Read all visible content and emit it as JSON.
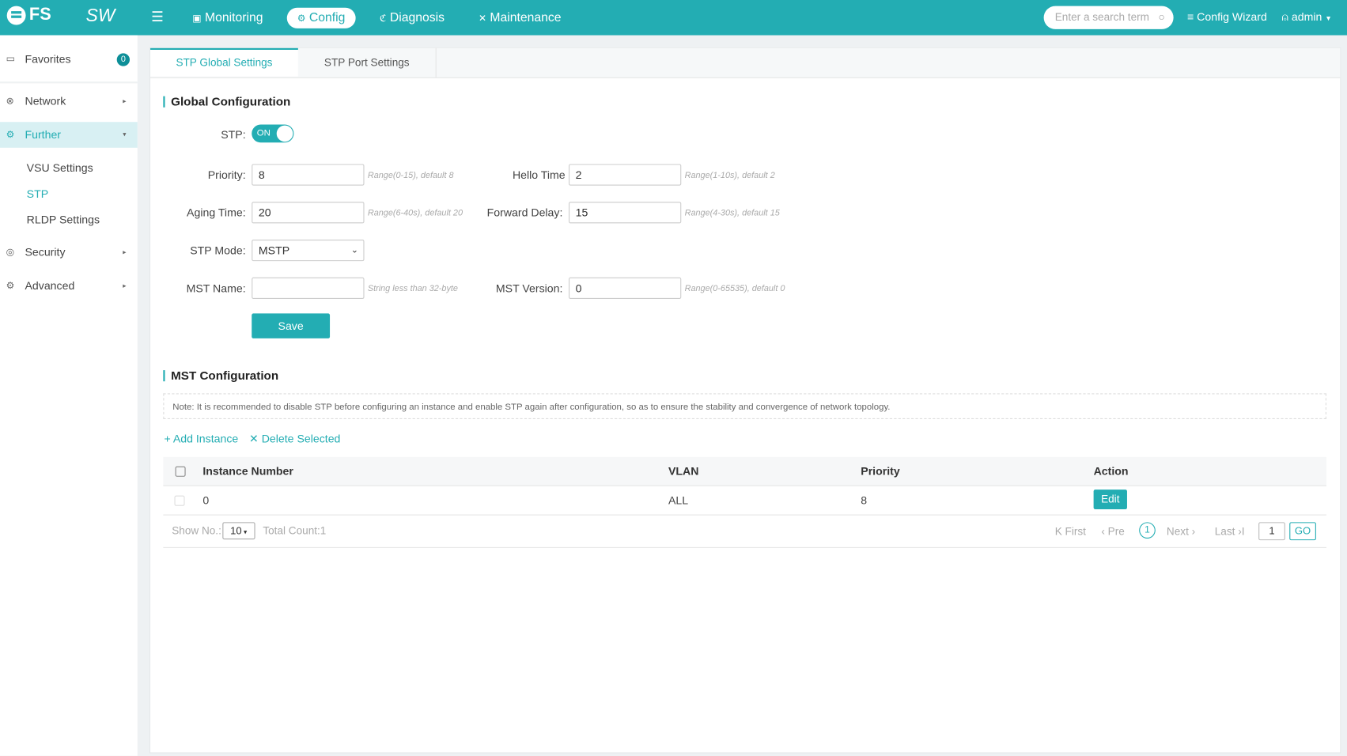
{
  "header": {
    "logo": "FS",
    "product": "SW",
    "nav": [
      {
        "label": "Monitoring",
        "icon": "monitor-icon"
      },
      {
        "label": "Config",
        "icon": "gear-icon"
      },
      {
        "label": "Diagnosis",
        "icon": "stethoscope-icon"
      },
      {
        "label": "Maintenance",
        "icon": "tools-icon"
      }
    ],
    "search_placeholder": "Enter a search term",
    "config_wizard": "Config Wizard",
    "user": "admin"
  },
  "sidebar": {
    "favorites": "Favorites",
    "favorites_count": "0",
    "items": [
      {
        "label": "Network"
      },
      {
        "label": "Further"
      },
      {
        "label": "Security"
      },
      {
        "label": "Advanced"
      }
    ],
    "sub_items": [
      "VSU Settings",
      "STP",
      "RLDP Settings"
    ]
  },
  "tabs": [
    "STP Global Settings",
    "STP Port Settings"
  ],
  "global": {
    "title": "Global Configuration",
    "stp_label": "STP:",
    "stp_state": "ON",
    "priority_label": "Priority:",
    "priority": "8",
    "priority_hint": "Range(0-15), default 8",
    "hello_label": "Hello Time",
    "hello": "2",
    "hello_hint": "Range(1-10s), default 2",
    "aging_label": "Aging Time:",
    "aging": "20",
    "aging_hint": "Range(6-40s), default 20",
    "forward_label": "Forward Delay:",
    "forward": "15",
    "forward_hint": "Range(4-30s), default 15",
    "mode_label": "STP Mode:",
    "mode": "MSTP",
    "mst_name_label": "MST Name:",
    "mst_name": "",
    "mst_name_hint": "String less than 32-byte",
    "mst_version_label": "MST Version:",
    "mst_version": "0",
    "mst_version_hint": "Range(0-65535), default 0",
    "save": "Save"
  },
  "mst": {
    "title": "MST Configuration",
    "note": "Note: It is recommended to disable STP before configuring an instance and enable STP again after configuration, so as to ensure the stability and convergence of network topology.",
    "add": "+ Add Instance",
    "delete": "✕ Delete Selected",
    "columns": [
      "Instance Number",
      "VLAN",
      "Priority",
      "Action"
    ],
    "rows": [
      {
        "instance": "0",
        "vlan": "ALL",
        "priority": "8",
        "action": "Edit"
      }
    ],
    "show_no_label": "Show No.:",
    "page_size": "10",
    "total": "Total Count:1",
    "pager": {
      "first": "First",
      "pre": "Pre",
      "current": "1",
      "next": "Next",
      "last": "Last",
      "goto": "1",
      "go": "GO"
    }
  }
}
